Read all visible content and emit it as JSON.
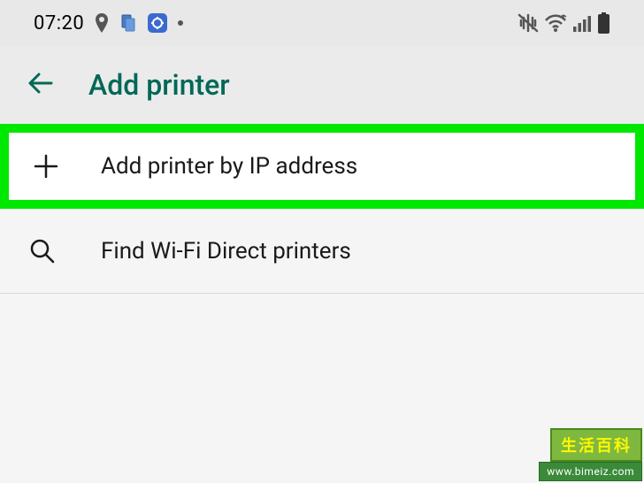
{
  "status": {
    "time": "07:20"
  },
  "header": {
    "title": "Add printer"
  },
  "options": {
    "add_by_ip": "Add printer by IP address",
    "find_wifi_direct": "Find Wi-Fi Direct printers"
  },
  "watermark": {
    "top": "生活百科",
    "bottom": "www.bimeiz.com"
  }
}
